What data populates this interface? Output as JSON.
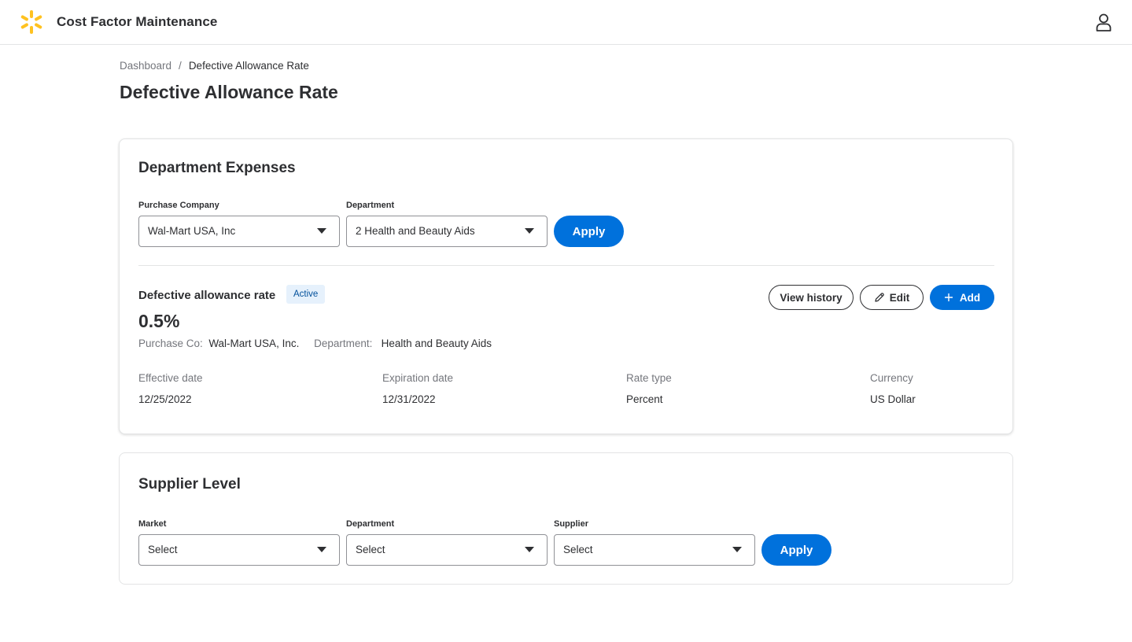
{
  "header": {
    "app_title": "Cost Factor Maintenance",
    "logo_icon": "spark-logo-icon",
    "user_icon": "user-icon",
    "brand_color": "#ffc220"
  },
  "breadcrumb": {
    "items": [
      "Dashboard",
      "Defective Allowance Rate"
    ],
    "separator": "/"
  },
  "page_title": "Defective Allowance Rate",
  "department_expenses": {
    "title": "Department Expenses",
    "purchase_company": {
      "label": "Purchase Company",
      "value": "Wal-Mart USA, Inc"
    },
    "department": {
      "label": "Department",
      "value": "2 Health and Beauty Aids"
    },
    "apply_label": "Apply",
    "rate": {
      "title": "Defective allowance rate",
      "status": "Active",
      "value": "0.5%",
      "purchase_co_label": "Purchase Co:",
      "purchase_co_value": "Wal-Mart USA, Inc.",
      "department_label": "Department:",
      "department_value": "Health and Beauty Aids",
      "view_history_label": "View history",
      "edit_label": "Edit",
      "add_label": "Add",
      "details": [
        {
          "label": "Effective date",
          "value": "12/25/2022"
        },
        {
          "label": "Expiration date",
          "value": "12/31/2022"
        },
        {
          "label": "Rate type",
          "value": "Percent"
        },
        {
          "label": "Currency",
          "value": "US Dollar"
        }
      ]
    }
  },
  "supplier_level": {
    "title": "Supplier Level",
    "market": {
      "label": "Market",
      "value": "Select"
    },
    "department": {
      "label": "Department",
      "value": "Select"
    },
    "supplier": {
      "label": "Supplier",
      "value": "Select"
    },
    "apply_label": "Apply"
  },
  "colors": {
    "primary": "#0071dc",
    "text": "#2e2f32",
    "muted": "#74767c",
    "badge_bg": "#e6f1fc",
    "badge_text": "#004f9a"
  }
}
